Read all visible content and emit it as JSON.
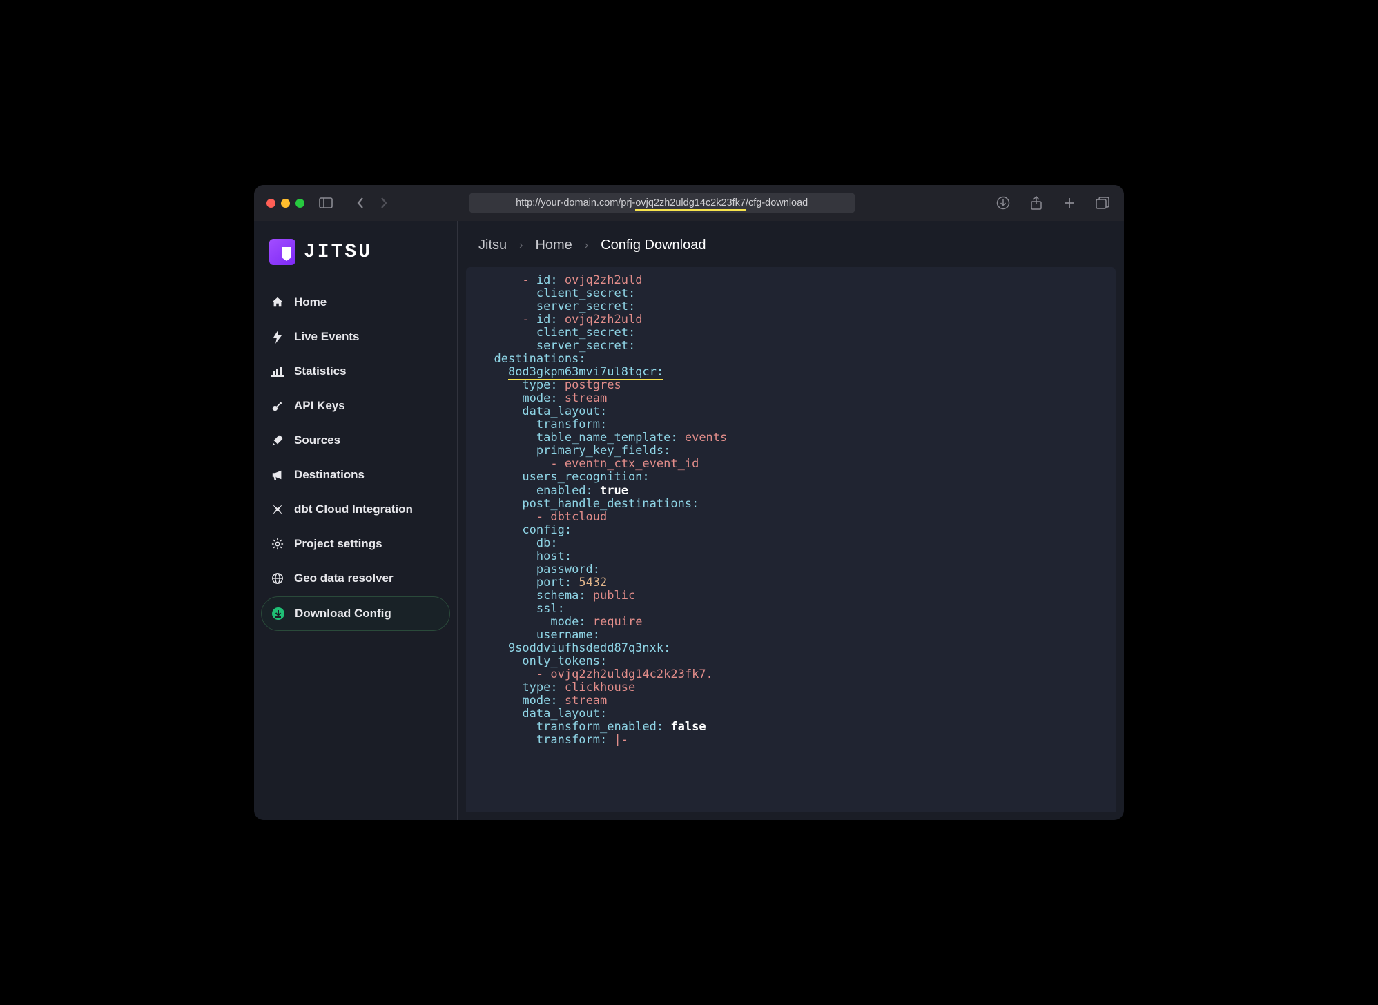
{
  "url": {
    "prefix": "http://your-domain.com/prj-",
    "highlighted": "ovjq2zh2uldg14c2k23fk7",
    "suffix": "/cfg-download"
  },
  "logo": {
    "text": "JITSU"
  },
  "sidebar": {
    "items": [
      {
        "label": "Home",
        "icon": "home-icon",
        "active": false
      },
      {
        "label": "Live Events",
        "icon": "bolt-icon",
        "active": false
      },
      {
        "label": "Statistics",
        "icon": "chart-icon",
        "active": false
      },
      {
        "label": "API Keys",
        "icon": "key-icon",
        "active": false
      },
      {
        "label": "Sources",
        "icon": "rocket-icon",
        "active": false
      },
      {
        "label": "Destinations",
        "icon": "megaphone-icon",
        "active": false
      },
      {
        "label": "dbt Cloud Integration",
        "icon": "dbt-icon",
        "active": false
      },
      {
        "label": "Project settings",
        "icon": "gear-icon",
        "active": false
      },
      {
        "label": "Geo data resolver",
        "icon": "globe-icon",
        "active": false
      },
      {
        "label": "Download Config",
        "icon": "download-icon",
        "active": true
      }
    ]
  },
  "breadcrumbs": [
    "Jitsu",
    "Home",
    "Config Download"
  ],
  "code": {
    "lines": [
      {
        "indent": 3,
        "dash": true,
        "key": "id",
        "val": "ovjq2zh2uld",
        "valType": "val"
      },
      {
        "indent": 4,
        "key": "client_secret",
        "val": ""
      },
      {
        "indent": 4,
        "key": "server_secret",
        "val": ""
      },
      {
        "indent": 3,
        "dash": true,
        "key": "id",
        "val": "ovjq2zh2uld",
        "valType": "val"
      },
      {
        "indent": 4,
        "key": "client_secret",
        "val": ""
      },
      {
        "indent": 4,
        "key": "server_secret",
        "val": ""
      },
      {
        "indent": 1,
        "key": "destinations",
        "val": ""
      },
      {
        "indent": 2,
        "key": "8od3gkpm63mvi7ul8tqcr",
        "val": "",
        "underline": true
      },
      {
        "indent": 3,
        "key": "type",
        "val": "postgres",
        "valType": "val"
      },
      {
        "indent": 3,
        "key": "mode",
        "val": "stream",
        "valType": "val"
      },
      {
        "indent": 3,
        "key": "data_layout",
        "val": ""
      },
      {
        "indent": 4,
        "key": "transform",
        "val": ""
      },
      {
        "indent": 4,
        "key": "table_name_template",
        "val": "events",
        "valType": "val"
      },
      {
        "indent": 4,
        "key": "primary_key_fields",
        "val": ""
      },
      {
        "indent": 5,
        "dash": true,
        "listVal": "eventn_ctx_event_id"
      },
      {
        "indent": 3,
        "key": "users_recognition",
        "val": ""
      },
      {
        "indent": 4,
        "key": "enabled",
        "val": "true",
        "valType": "bool"
      },
      {
        "indent": 3,
        "key": "post_handle_destinations",
        "val": ""
      },
      {
        "indent": 4,
        "dash": true,
        "listVal": "dbtcloud"
      },
      {
        "indent": 3,
        "key": "config",
        "val": ""
      },
      {
        "indent": 4,
        "key": "db",
        "val": ""
      },
      {
        "indent": 4,
        "key": "host",
        "val": ""
      },
      {
        "indent": 4,
        "key": "password",
        "val": ""
      },
      {
        "indent": 4,
        "key": "port",
        "val": "5432",
        "valType": "num"
      },
      {
        "indent": 4,
        "key": "schema",
        "val": "public",
        "valType": "val"
      },
      {
        "indent": 4,
        "key": "ssl",
        "val": ""
      },
      {
        "indent": 5,
        "key": "mode",
        "val": "require",
        "valType": "val"
      },
      {
        "indent": 4,
        "key": "username",
        "val": ""
      },
      {
        "indent": 2,
        "key": "9soddviufhsdedd87q3nxk",
        "val": ""
      },
      {
        "indent": 3,
        "key": "only_tokens",
        "val": ""
      },
      {
        "indent": 4,
        "dash": true,
        "listVal": "ovjq2zh2uldg14c2k23fk7."
      },
      {
        "indent": 3,
        "key": "type",
        "val": "clickhouse",
        "valType": "val"
      },
      {
        "indent": 3,
        "key": "mode",
        "val": "stream",
        "valType": "val"
      },
      {
        "indent": 3,
        "key": "data_layout",
        "val": ""
      },
      {
        "indent": 4,
        "key": "transform_enabled",
        "val": "false",
        "valType": "bool"
      },
      {
        "indent": 4,
        "key": "transform",
        "val": "|-",
        "valType": "val"
      }
    ]
  }
}
